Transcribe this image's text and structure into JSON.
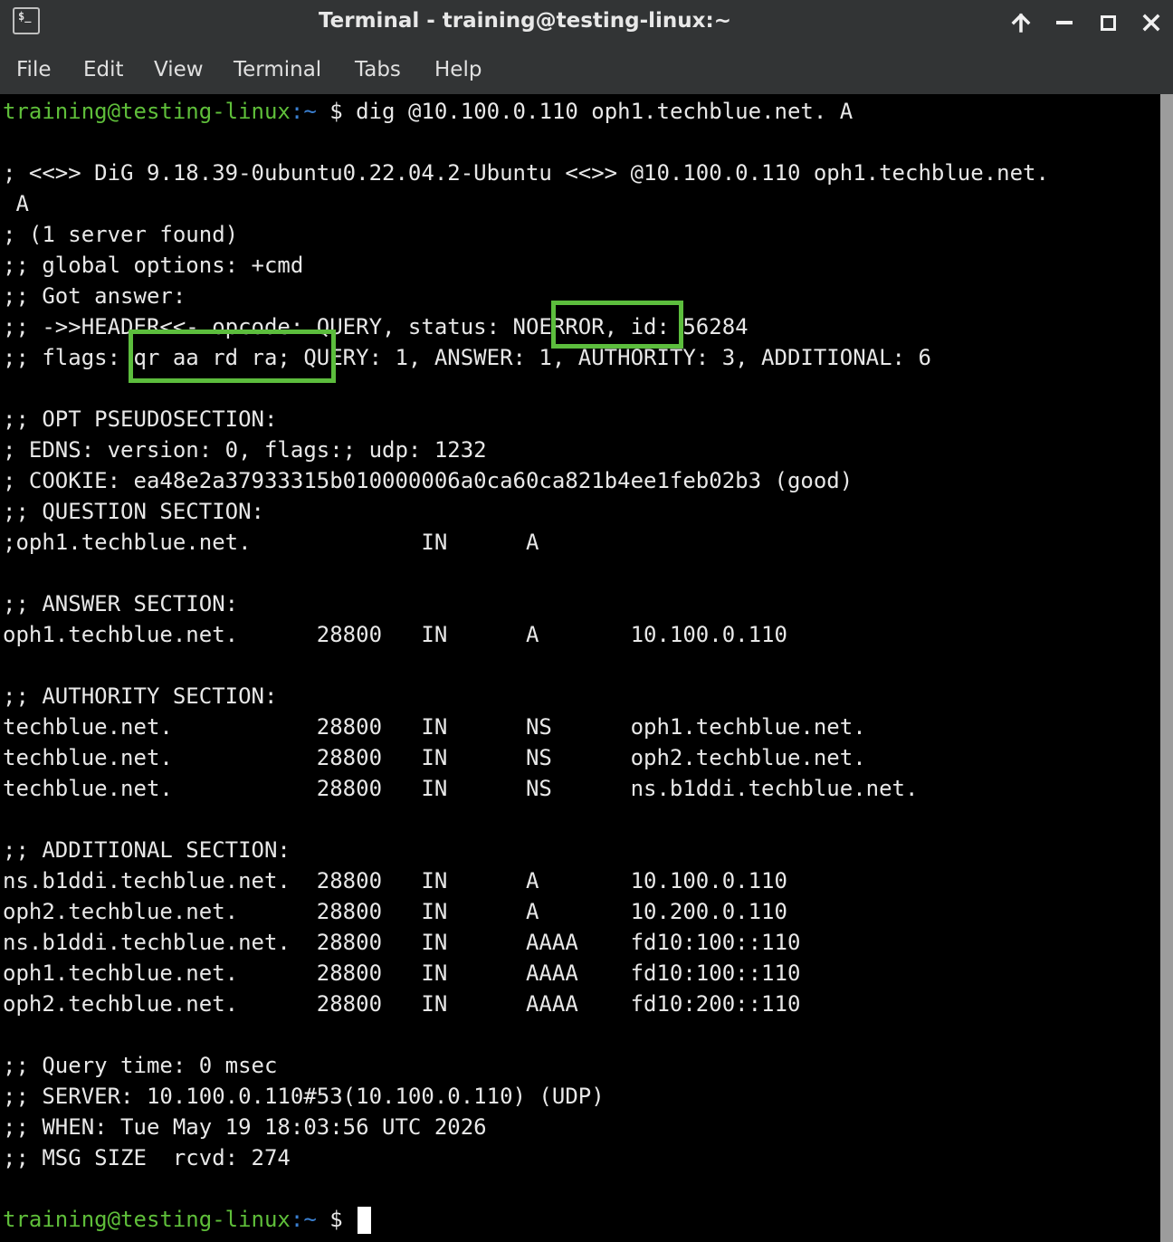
{
  "window": {
    "title": "Terminal - training@testing-linux:~",
    "app_icon_text": "$_",
    "controls": [
      "up-arrow-icon",
      "minimize-icon",
      "maximize-icon",
      "close-icon"
    ]
  },
  "menu": [
    "File",
    "Edit",
    "View",
    "Terminal",
    "Tabs",
    "Help"
  ],
  "prompt": {
    "user_host": "training@testing-linux",
    "path": ":~",
    "symbol": " $ "
  },
  "command": "dig @10.100.0.110 oph1.techblue.net. A",
  "output": [
    "",
    "; <<>> DiG 9.18.39-0ubuntu0.22.04.2-Ubuntu <<>> @10.100.0.110 oph1.techblue.net.",
    " A",
    "; (1 server found)",
    ";; global options: +cmd",
    ";; Got answer:",
    ";; ->>HEADER<<- opcode: QUERY, status: NOERROR, id: 56284",
    ";; flags: qr aa rd ra; QUERY: 1, ANSWER: 1, AUTHORITY: 3, ADDITIONAL: 6",
    "",
    ";; OPT PSEUDOSECTION:",
    "; EDNS: version: 0, flags:; udp: 1232",
    "; COOKIE: ea48e2a37933315b010000006a0ca60ca821b4ee1feb02b3 (good)",
    ";; QUESTION SECTION:",
    ";oph1.techblue.net.             IN      A",
    "",
    ";; ANSWER SECTION:",
    "oph1.techblue.net.      28800   IN      A       10.100.0.110",
    "",
    ";; AUTHORITY SECTION:",
    "techblue.net.           28800   IN      NS      oph1.techblue.net.",
    "techblue.net.           28800   IN      NS      oph2.techblue.net.",
    "techblue.net.           28800   IN      NS      ns.b1ddi.techblue.net.",
    "",
    ";; ADDITIONAL SECTION:",
    "ns.b1ddi.techblue.net.  28800   IN      A       10.100.0.110",
    "oph2.techblue.net.      28800   IN      A       10.200.0.110",
    "ns.b1ddi.techblue.net.  28800   IN      AAAA    fd10:100::110",
    "oph1.techblue.net.      28800   IN      AAAA    fd10:100::110",
    "oph2.techblue.net.      28800   IN      AAAA    fd10:200::110",
    "",
    ";; Query time: 0 msec",
    ";; SERVER: 10.100.0.110#53(10.100.0.110) (UDP)",
    ";; WHEN: Tue May 19 18:03:56 UTC 2026",
    ";; MSG SIZE  rcvd: 274",
    ""
  ],
  "highlights": [
    "NOERROR",
    "qr aa rd ra;"
  ],
  "colors": {
    "highlight_box": "#5cbd3d",
    "prompt_user": "#5fbf3a",
    "prompt_path": "#3a7fd0",
    "text": "#e8e8e8",
    "background": "#000000"
  }
}
